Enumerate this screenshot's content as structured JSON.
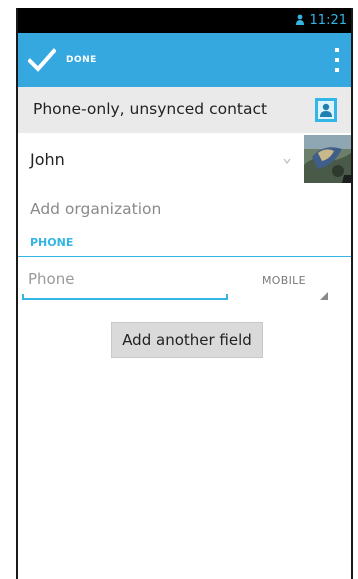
{
  "status_bar": {
    "time": "11:21",
    "notification_icon": "person-notification-icon"
  },
  "action_bar": {
    "done_label": "DONE",
    "done_icon": "checkmark-icon",
    "menu_icon": "overflow-menu-icon"
  },
  "account": {
    "title": "Phone-only, unsynced contact",
    "icon": "contact-card-icon"
  },
  "name": {
    "value": "John",
    "expand_icon": "expand-arrow-icon",
    "photo": "contact-photo"
  },
  "organization": {
    "placeholder": "Add organization"
  },
  "phone_section": {
    "header": "PHONE",
    "input_placeholder": "Phone",
    "type": "MOBILE"
  },
  "add_field": {
    "label": "Add another field"
  },
  "colors": {
    "accent": "#33b5e5",
    "action_bar": "#35a8e0",
    "header_bg": "#eaeaea",
    "status_bar": "#000000"
  }
}
